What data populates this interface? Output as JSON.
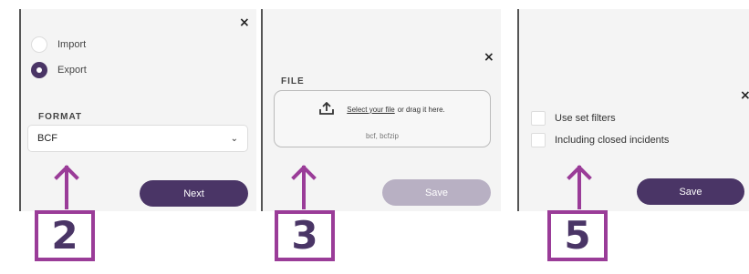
{
  "panel_import_export": {
    "radio_import_label": "Import",
    "radio_export_label": "Export",
    "format_label": "FORMAT",
    "format_selected": "BCF",
    "next_label": "Next",
    "close_glyph": "×"
  },
  "panel_file": {
    "file_label": "FILE",
    "upload_link_text": "Select your file",
    "upload_suffix_text": "or drag it here.",
    "accepted_formats": "bcf, bcfzip",
    "save_label": "Save",
    "close_glyph": "×"
  },
  "panel_filters": {
    "use_set_filters_label": "Use set filters",
    "including_closed_label": "Including closed incidents",
    "save_label": "Save",
    "close_glyph": "×"
  },
  "steps": [
    "2",
    "3",
    "5"
  ],
  "colors": {
    "primary": "#4a3566",
    "disabled": "#b8b0c3",
    "annotation": "#9a3c98"
  }
}
